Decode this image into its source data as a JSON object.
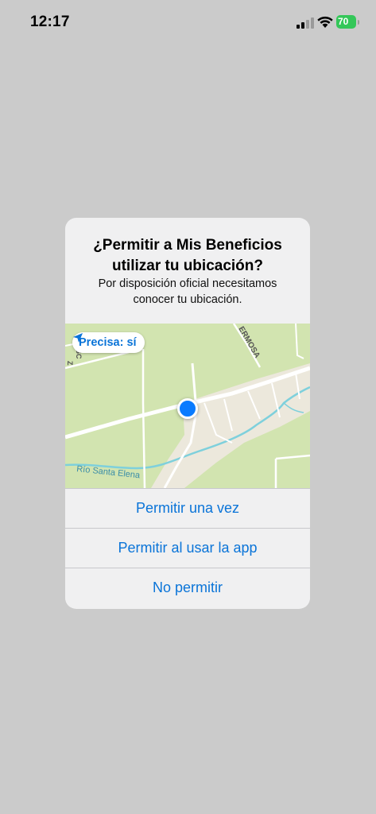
{
  "status_bar": {
    "time": "12:17",
    "battery_level": "70",
    "battery_color": "#34c759"
  },
  "dialog": {
    "title": "¿Permitir a Mis Beneficios utilizar tu ubicación?",
    "message": "Por disposición oficial necesitamos conocer tu ubicación.",
    "map": {
      "precise_label": "Precisa: sí",
      "labels": {
        "river": "Río Santa Elena",
        "street_partial": "ERMOSA",
        "street_left": "SC",
        "street_left_b": "Z"
      }
    },
    "actions": [
      {
        "label": "Permitir una vez"
      },
      {
        "label": "Permitir al usar la app"
      },
      {
        "label": "No permitir"
      }
    ],
    "accent_color": "#0a74d8"
  }
}
